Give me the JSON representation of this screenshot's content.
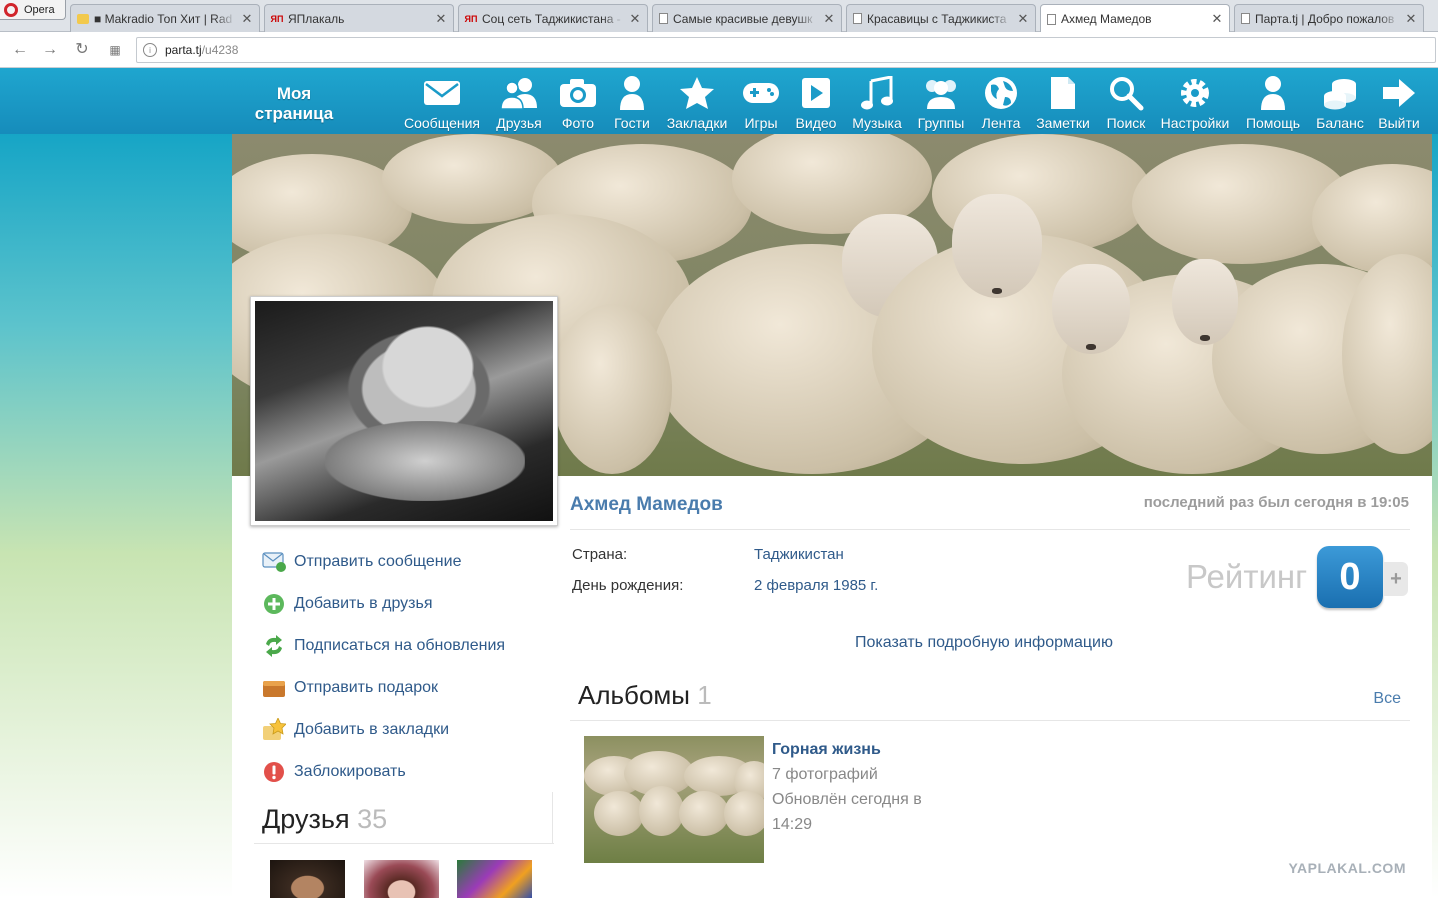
{
  "browser": {
    "menu_label": "Opera",
    "tabs": [
      {
        "title": "■ Makradio Топ Хит | Rad",
        "icon": "folder"
      },
      {
        "title": "ЯПлакаль",
        "icon": "yap"
      },
      {
        "title": "Соц сеть Таджикистана -",
        "icon": "yap"
      },
      {
        "title": "Самые красивые девушк",
        "icon": "doc"
      },
      {
        "title": "Красавицы с Таджикиста",
        "icon": "doc"
      },
      {
        "title": "Ахмед Мамедов",
        "icon": "doc"
      },
      {
        "title": "Парта.tj | Добро пожалов",
        "icon": "doc"
      }
    ],
    "active_tab": 5,
    "yap_favicon_text": "ЯП",
    "close_glyph": "✕",
    "url_host": "parta.tj",
    "url_path": "/u4238"
  },
  "header": {
    "my_page_label": "Моя страница",
    "nav": [
      {
        "label": "Сообщения",
        "icon": "envelope-icon"
      },
      {
        "label": "Друзья",
        "icon": "friends-icon"
      },
      {
        "label": "Фото",
        "icon": "camera-icon"
      },
      {
        "label": "Гости",
        "icon": "guest-icon"
      },
      {
        "label": "Закладки",
        "icon": "star-icon"
      },
      {
        "label": "Игры",
        "icon": "gamepad-icon"
      },
      {
        "label": "Видео",
        "icon": "play-icon"
      },
      {
        "label": "Музыка",
        "icon": "music-icon"
      },
      {
        "label": "Группы",
        "icon": "group-icon"
      },
      {
        "label": "Лента",
        "icon": "globe-icon"
      },
      {
        "label": "Заметки",
        "icon": "note-icon"
      },
      {
        "label": "Поиск",
        "icon": "search-icon"
      },
      {
        "label": "Настройки",
        "icon": "gear-icon"
      },
      {
        "label": "Помощь",
        "icon": "help-icon"
      },
      {
        "label": "Баланс",
        "icon": "coins-icon"
      },
      {
        "label": "Выйти",
        "icon": "exit-arrow-icon"
      }
    ]
  },
  "profile": {
    "name": "Ахмед Мамедов",
    "last_seen": "последний раз был сегодня в 19:05",
    "country_label": "Страна:",
    "country_value": "Таджикистан",
    "birthday_label": "День рождения:",
    "birthday_value": "2 февраля 1985 г.",
    "rating_label": "Рейтинг",
    "rating_value": "0",
    "rating_plus": "+",
    "show_more": "Показать подробную информацию"
  },
  "actions": [
    {
      "label": "Отправить сообщение",
      "icon": "mail-icon"
    },
    {
      "label": "Добавить в друзья",
      "icon": "add-icon"
    },
    {
      "label": "Подписаться на обновления",
      "icon": "refresh-icon"
    },
    {
      "label": "Отправить подарок",
      "icon": "gift-icon"
    },
    {
      "label": "Добавить в закладки",
      "icon": "bookmark-star-icon"
    },
    {
      "label": "Заблокировать",
      "icon": "block-icon"
    }
  ],
  "albums": {
    "title": "Альбомы",
    "count": "1",
    "all_label": "Все",
    "items": [
      {
        "name": "Горная жизнь",
        "photos": "7 фотографий",
        "updated_line1": "Обновлён сегодня в",
        "updated_line2": "14:29"
      }
    ]
  },
  "friends": {
    "title": "Друзья",
    "count": "35"
  },
  "watermark": "YAPLAKAL.COM",
  "colors": {
    "header_blue": "#1a9bc8",
    "link_blue": "#2f5a8a",
    "name_blue": "#4a7cad",
    "rating_badge": "#1f78bd"
  }
}
